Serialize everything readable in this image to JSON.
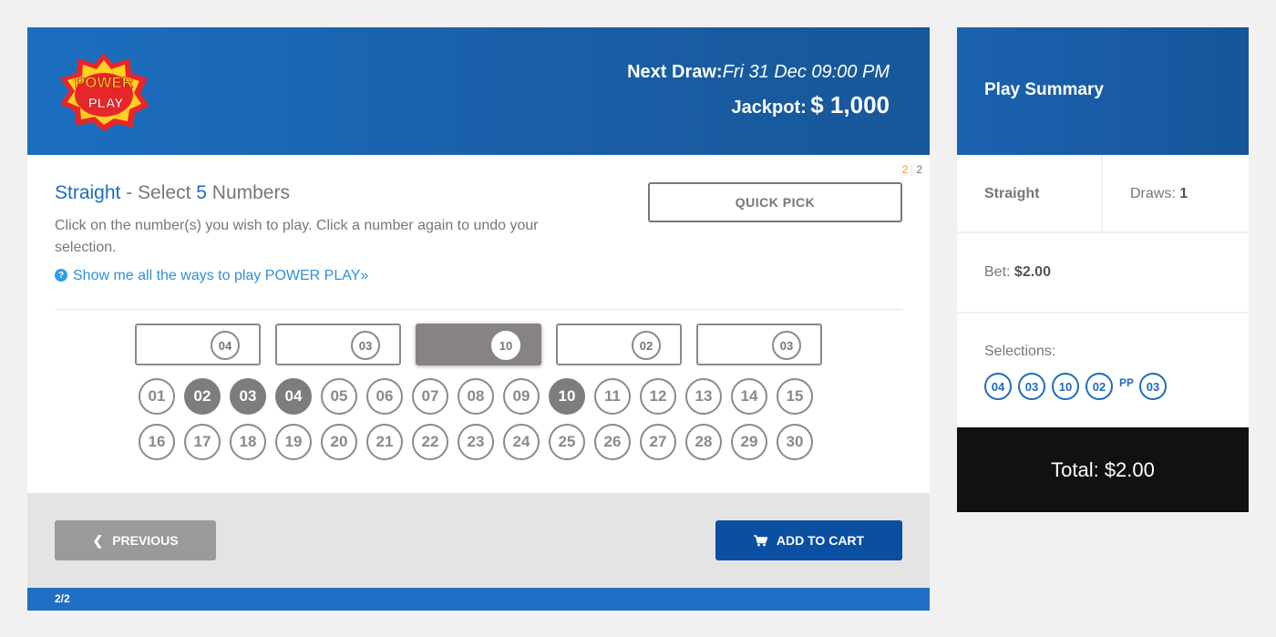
{
  "header": {
    "logo_text_top": "POWER",
    "logo_text_bottom": "PLAY",
    "next_draw_label": "Next Draw:",
    "next_draw_value": "Fri 31 Dec 09:00 PM",
    "jackpot_label": "Jackpot:",
    "jackpot_value": "$ 1,000"
  },
  "step": {
    "current": "2",
    "total": "2"
  },
  "game": {
    "title_type": "Straight",
    "title_sep": " - Select ",
    "title_count": "5",
    "title_suffix": " Numbers",
    "instructions": "Click on the number(s) you wish to play. Click a number again to undo your selection.",
    "help_icon": "?",
    "help_link": "Show me all the ways to play POWER PLAY»",
    "quick_pick_label": "QUICK PICK"
  },
  "slots": [
    {
      "value": "04",
      "active": false
    },
    {
      "value": "03",
      "active": false
    },
    {
      "value": "10",
      "active": true
    },
    {
      "value": "02",
      "active": false
    },
    {
      "value": "03",
      "active": false
    }
  ],
  "numbers": [
    "01",
    "02",
    "03",
    "04",
    "05",
    "06",
    "07",
    "08",
    "09",
    "10",
    "11",
    "12",
    "13",
    "14",
    "15",
    "16",
    "17",
    "18",
    "19",
    "20",
    "21",
    "22",
    "23",
    "24",
    "25",
    "26",
    "27",
    "28",
    "29",
    "30"
  ],
  "selected_numbers": [
    "02",
    "03",
    "04",
    "10"
  ],
  "footer": {
    "previous_label": "PREVIOUS",
    "previous_icon": "chevron-left-icon",
    "add_to_cart_label": "ADD TO CART",
    "add_to_cart_icon": "cart-icon",
    "progress_text": "2/2"
  },
  "summary": {
    "title": "Play Summary",
    "bet_type": "Straight",
    "draws_label": "Draws:",
    "draws_value": "1",
    "bet_label": "Bet:",
    "bet_value": "$2.00",
    "selections_label": "Selections:",
    "selections": [
      "04",
      "03",
      "10",
      "02"
    ],
    "pp_label": "PP",
    "pp_value": "03",
    "total_text": "Total: $2.00"
  },
  "colors": {
    "brand_blue": "#1f6bbf",
    "cart_button": "#0b4fa3",
    "selected_ball": "#7f7c7c",
    "total_bg": "#111111",
    "step_current": "#e8963c"
  }
}
